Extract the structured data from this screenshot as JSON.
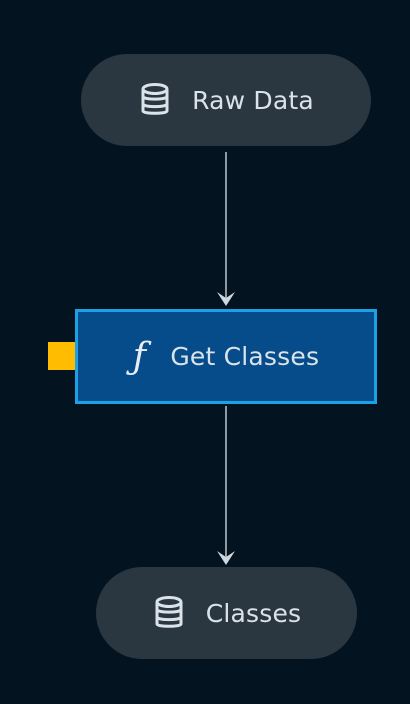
{
  "colors": {
    "background": "#031320",
    "dataset_node": "#2b3740",
    "function_node": "#064c8a",
    "function_border": "#1ca0e6",
    "edge": "#8d9aa3",
    "marker": "#ffbc00",
    "text": "#dbe3ea"
  },
  "nodes": {
    "raw_data": {
      "label": "Raw Data",
      "icon": "database-icon"
    },
    "get_classes": {
      "label": "Get Classes",
      "icon": "function-icon",
      "glyph": "ƒ"
    },
    "classes": {
      "label": "Classes",
      "icon": "database-icon"
    }
  },
  "edges": [
    {
      "from": "Raw Data",
      "to": "Get Classes"
    },
    {
      "from": "Get Classes",
      "to": "Classes"
    }
  ]
}
